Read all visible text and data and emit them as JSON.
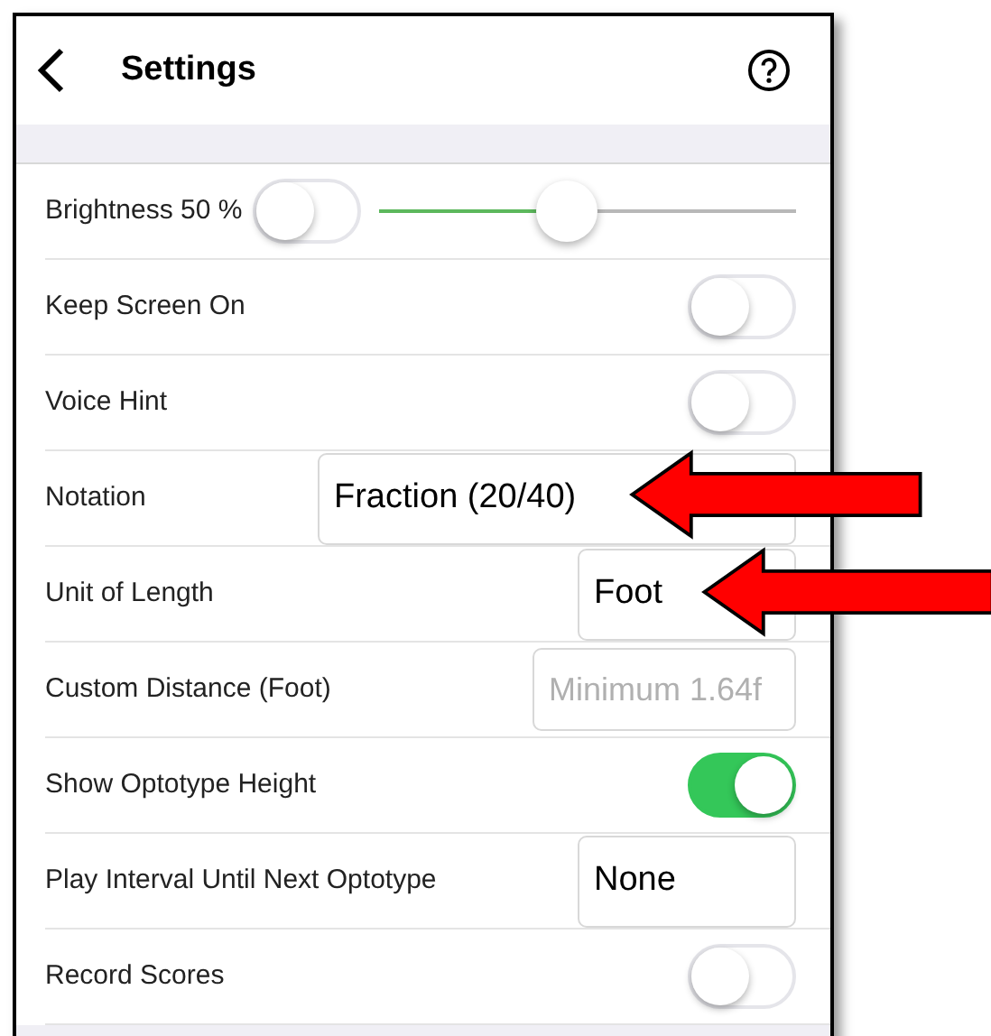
{
  "header": {
    "title": "Settings"
  },
  "rows": [
    {
      "kind": "slider",
      "label": "Brightness 50 %",
      "on": false,
      "level": 0.45
    },
    {
      "kind": "toggle",
      "label": "Keep Screen On",
      "on": false
    },
    {
      "kind": "toggle",
      "label": "Voice Hint",
      "on": false
    },
    {
      "kind": "select",
      "label": "Notation",
      "value": "Fraction (20/40)",
      "wide": true
    },
    {
      "kind": "select",
      "label": "Unit of Length",
      "value": "Foot",
      "wide": false
    },
    {
      "kind": "input",
      "label": "Custom Distance (Foot)",
      "placeholder": "Minimum 1.64f"
    },
    {
      "kind": "toggle",
      "label": "Show Optotype Height",
      "on": true
    },
    {
      "kind": "select",
      "label": "Play Interval Until Next Optotype",
      "value": "None",
      "wide": false
    },
    {
      "kind": "toggle",
      "label": "Record Scores",
      "on": false
    }
  ]
}
